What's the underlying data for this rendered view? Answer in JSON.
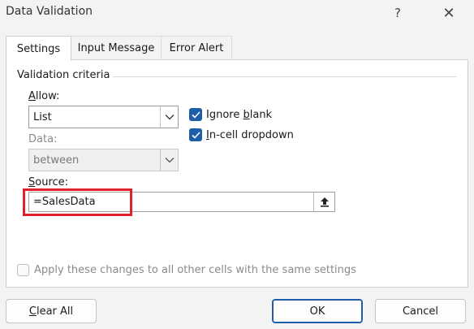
{
  "window": {
    "title": "Data Validation",
    "help": "?",
    "close": "✕"
  },
  "tabs": [
    {
      "label": "Settings",
      "active": true
    },
    {
      "label": "Input Message",
      "active": false
    },
    {
      "label": "Error Alert",
      "active": false
    }
  ],
  "group": {
    "label": "Validation criteria"
  },
  "allow": {
    "label_key": "A",
    "label_rest": "llow:",
    "value": "List"
  },
  "data": {
    "label": "Data:",
    "value": "between"
  },
  "ignore_blank": {
    "label_pre": "Ignore ",
    "label_key": "b",
    "label_rest": "lank",
    "checked": true
  },
  "incell_dropdown": {
    "label_key": "I",
    "label_rest": "n-cell dropdown",
    "checked": true
  },
  "source": {
    "label_key": "S",
    "label_rest": "ource:",
    "value": "=SalesData"
  },
  "apply_all": {
    "label": "Apply these changes to all other cells with the same settings",
    "checked": false
  },
  "buttons": {
    "clear_key": "C",
    "clear_rest": "lear All",
    "ok": "OK",
    "cancel": "Cancel"
  },
  "colors": {
    "accent": "#1e5ea8",
    "highlight": "#e0202c"
  }
}
